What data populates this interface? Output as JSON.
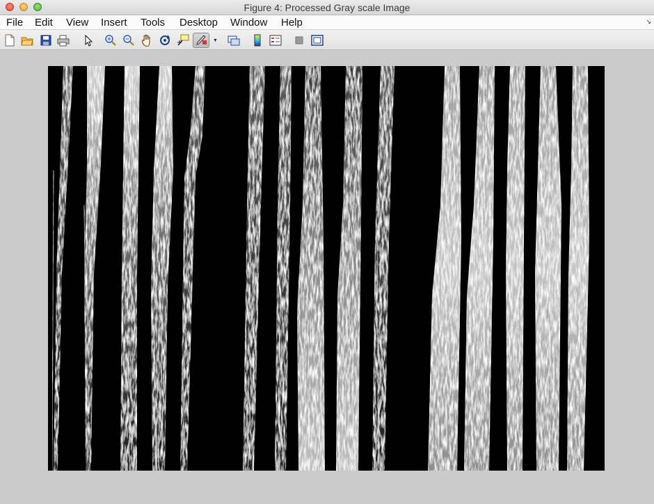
{
  "window": {
    "title": "Figure 4: Processed Gray scale Image"
  },
  "menu": {
    "items": [
      {
        "label": "File"
      },
      {
        "label": "Edit"
      },
      {
        "label": "View"
      },
      {
        "label": "Insert"
      },
      {
        "label": "Tools"
      },
      {
        "label": "Desktop"
      },
      {
        "label": "Window"
      },
      {
        "label": "Help"
      }
    ]
  },
  "toolbar": {
    "buttons": [
      {
        "icon": "new-figure-icon"
      },
      {
        "icon": "open-file-icon"
      },
      {
        "icon": "save-icon"
      },
      {
        "icon": "print-icon"
      },
      {
        "icon": "pointer-icon"
      },
      {
        "icon": "zoom-in-icon"
      },
      {
        "icon": "zoom-out-icon"
      },
      {
        "icon": "pan-hand-icon"
      },
      {
        "icon": "rotate-3d-icon"
      },
      {
        "icon": "data-cursor-icon"
      },
      {
        "icon": "brush-icon",
        "pressed": true
      },
      {
        "icon": "link-plot-icon"
      },
      {
        "icon": "colorbar-icon"
      },
      {
        "icon": "legend-icon"
      },
      {
        "icon": "hide-plot-tools-icon"
      },
      {
        "icon": "show-plot-tools-icon"
      }
    ]
  },
  "colors": {
    "background": "#cbcbcb",
    "image_background": "#000000"
  },
  "image": {
    "description": "grayscale image of vertical fiber strands"
  }
}
